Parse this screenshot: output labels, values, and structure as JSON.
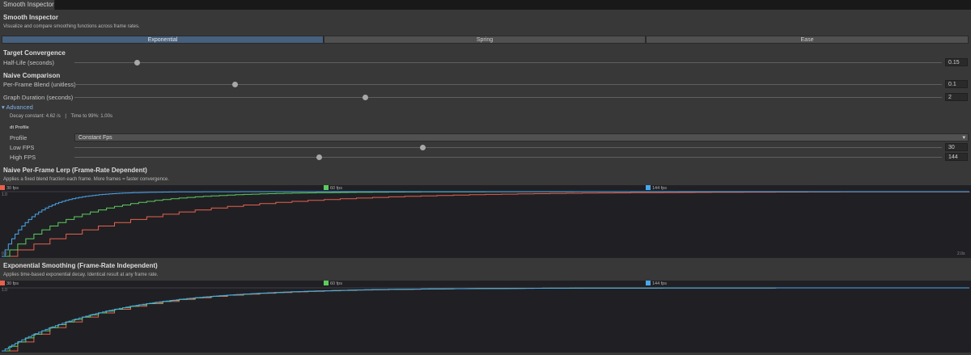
{
  "tab": {
    "title": "Smooth Inspector"
  },
  "header": {
    "title": "Smooth Inspector",
    "subtitle": "Visualize and compare smoothing functions across frame rates."
  },
  "modes": [
    {
      "label": "Exponential",
      "active": true
    },
    {
      "label": "Spring",
      "active": false
    },
    {
      "label": "Ease",
      "active": false
    }
  ],
  "target": {
    "heading": "Target Convergence",
    "half_life": {
      "label": "Half-Life (seconds)",
      "value": "0.15",
      "fraction": 0.07
    }
  },
  "naive": {
    "heading": "Naive Comparison",
    "blend": {
      "label": "Per-Frame Blend (unitless)",
      "value": "0.1",
      "fraction": 0.18
    },
    "duration": {
      "label": "Graph Duration (seconds)",
      "value": "2",
      "fraction": 0.33
    }
  },
  "advanced": {
    "label": "Advanced",
    "decay_text": "Decay constant: 4.62 /s",
    "separator": "|",
    "time_text": "Time to 99%: 1.00s",
    "dt_profile_heading": "dt Profile",
    "profile": {
      "label": "Profile",
      "value": "Constant Fps"
    },
    "low_fps": {
      "label": "Low FPS",
      "value": "30",
      "fraction": 0.4
    },
    "high_fps": {
      "label": "High FPS",
      "value": "144",
      "fraction": 0.28
    }
  },
  "colors": {
    "fps30": "#e8604c",
    "fps60": "#5ccc5c",
    "fps144": "#4aa6ec",
    "accent": "#46607e"
  },
  "graph1": {
    "title": "Naive Per-Frame Lerp (Frame-Rate Dependent)",
    "subtitle": "Applies a fixed blend fraction each frame. More frames = faster convergence.",
    "legend": [
      "30 fps",
      "60 fps",
      "144 fps"
    ],
    "y_max_label": "1.0",
    "x_start_label": "0.0",
    "x_end_label": "2.0s"
  },
  "graph2": {
    "title": "Exponential Smoothing (Frame-Rate Independent)",
    "subtitle": "Applies time-based exponential decay. Identical result at any frame rate.",
    "legend": [
      "30 fps",
      "60 fps",
      "144 fps"
    ],
    "y_max_label": "1.0"
  },
  "chart_data": [
    {
      "type": "line",
      "title": "Naive Per-Frame Lerp (Frame-Rate Dependent)",
      "xlim": [
        0,
        2
      ],
      "ylim": [
        0,
        1
      ],
      "series": [
        {
          "name": "30 fps",
          "fps": 30,
          "blend": 0.1
        },
        {
          "name": "60 fps",
          "fps": 60,
          "blend": 0.1
        },
        {
          "name": "144 fps",
          "fps": 144,
          "blend": 0.1
        }
      ]
    },
    {
      "type": "line",
      "title": "Exponential Smoothing (Frame-Rate Independent)",
      "xlim": [
        0,
        2
      ],
      "ylim": [
        0,
        1
      ],
      "series": [
        {
          "name": "30 fps",
          "fps": 30,
          "half_life": 0.15
        },
        {
          "name": "60 fps",
          "fps": 60,
          "half_life": 0.15
        },
        {
          "name": "144 fps",
          "fps": 144,
          "half_life": 0.15
        }
      ]
    }
  ]
}
